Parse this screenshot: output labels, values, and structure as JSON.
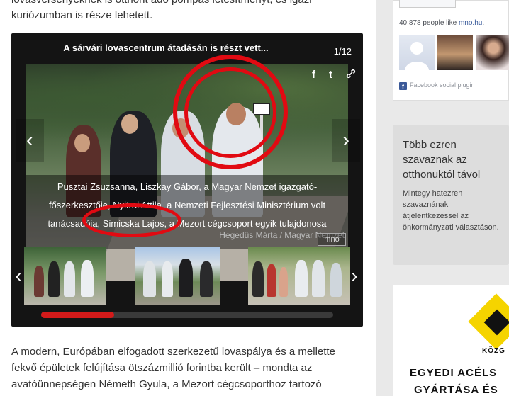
{
  "article": {
    "top_line_clipped": "lovasversenyeknek is otthont adó pompás létesítményt, és igazi",
    "top_line": "kuriózumban is része lehetett.",
    "body_lines": [
      "A modern, Európában elfogadott szerkezetű lovaspálya és a mellette",
      "fekvő épületek felújítása ötszázmillió forintba került – mondta az",
      "avatóünnepségen Németh Gyula, a Mezort cégcsoporthoz tartozó"
    ]
  },
  "gallery": {
    "title": "A sárvári lovascentrum átadásán is részt vett...",
    "counter": "1/12",
    "share_icons": [
      "facebook-icon",
      "twitter-icon",
      "link-icon"
    ],
    "caption_lines": [
      "Pusztai Zsuzsanna, Liszkay Gábor, a Magyar Nemzet igazgató-",
      "főszerkesztője, Nyitrai Attila, a Nemzeti Fejlesztési Minisztérium volt",
      "tanácsadója, Simicska Lajos, a Mezort cégcsoport egyik tulajdonosa"
    ],
    "credit": "Hegedüs Márta / Magyar Nemzet",
    "watermark": "mno",
    "progress": 0.25,
    "prev_glyph": "‹",
    "next_glyph": "›"
  },
  "sidebar": {
    "fb": {
      "count_text": "40,878 people like ",
      "page_link": "mno.hu",
      "count_suffix": ".",
      "plugin_label": "Facebook social plugin",
      "fb_glyph": "f"
    },
    "promo": {
      "title": "Több ezren szavaznak az otthonuktól távol",
      "text": "Mintegy hatezren szavaznának átjelentkezéssel az önkormányzati választáson."
    },
    "ad": {
      "brand": "KÖZG",
      "line1": "EGYEDI ACÉLS",
      "line2": "GYÁRTÁSA ÉS"
    }
  },
  "colors": {
    "annotation_red": "#e10a12",
    "progress_red": "#d31a1a",
    "fb_blue": "#3b5998"
  }
}
